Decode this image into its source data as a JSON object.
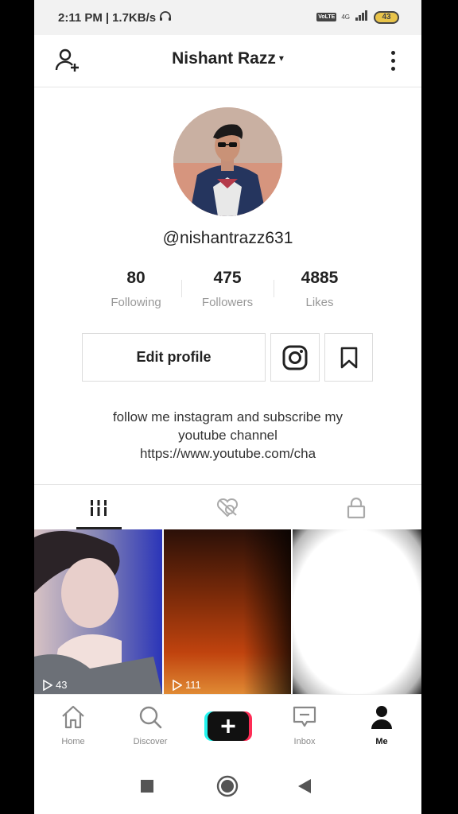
{
  "status_bar": {
    "time": "2:11 PM",
    "speed": "1.7KB/s",
    "volte": "VoLTE",
    "network": "4G",
    "battery": "43"
  },
  "header": {
    "profile_name": "Nishant Razz",
    "caret": "▾"
  },
  "profile": {
    "username": "@nishantrazz631",
    "stats": {
      "following": {
        "value": "80",
        "label": "Following"
      },
      "followers": {
        "value": "475",
        "label": "Followers"
      },
      "likes": {
        "value": "4885",
        "label": "Likes"
      }
    },
    "edit_profile_label": "Edit profile",
    "bio": {
      "line1": "follow me instagram and subscribe my",
      "line2": "youtube channel",
      "line3": "https://www.youtube.com/cha"
    }
  },
  "tabs": [
    {
      "name": "videos",
      "icon": "grid-icon",
      "active": true
    },
    {
      "name": "liked",
      "icon": "hidden-heart-icon",
      "active": false
    },
    {
      "name": "private",
      "icon": "lock-icon",
      "active": false
    }
  ],
  "videos": [
    {
      "plays": "43"
    },
    {
      "plays": "111"
    },
    {
      "plays": ""
    }
  ],
  "bottom_nav": {
    "home": "Home",
    "discover": "Discover",
    "inbox": "Inbox",
    "me": "Me"
  },
  "colors": {
    "accent_cyan": "#25f4ee",
    "accent_red": "#fe2c55",
    "battery": "#e9c44a"
  }
}
